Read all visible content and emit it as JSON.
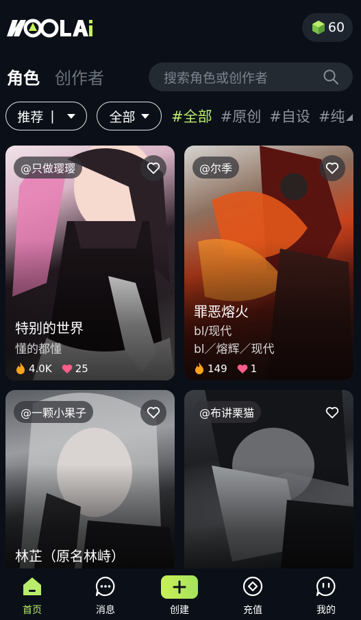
{
  "header": {
    "logo_text": "LOLAi",
    "gem_count": "60"
  },
  "tabs": {
    "role": "角色",
    "creator": "创作者"
  },
  "search": {
    "placeholder": "搜索角色或创作者"
  },
  "filters": {
    "sort_label": "推荐",
    "sort_separator": "|",
    "category_label": "全部",
    "hashtags": [
      "#全部",
      "#原创",
      "#自设",
      "#纯"
    ]
  },
  "cards": [
    {
      "author": "@只做璎璎",
      "title": "特别的世界",
      "subtitle": "懂的都懂",
      "tags": "",
      "views": "4.0K",
      "likes": "25"
    },
    {
      "author": "@尔季",
      "title": "罪恶熔火",
      "subtitle": "bl/现代",
      "tags": "bl／熔辉／现代",
      "views": "149",
      "likes": "1"
    },
    {
      "author": "@一颗小果子",
      "title": "林芷（原名林峙）",
      "subtitle": "",
      "tags": "",
      "views": "",
      "likes": ""
    },
    {
      "author": "@布讲栗猫",
      "title": "",
      "subtitle": "",
      "tags": "",
      "views": "",
      "likes": ""
    }
  ],
  "nav": {
    "home": "首页",
    "messages": "消息",
    "create": "创建",
    "recharge": "充值",
    "mine": "我的"
  },
  "colors": {
    "accent": "#b9ec6a",
    "background": "#0b1018",
    "heart": "#ff5c8a",
    "fire": "#ffa31a"
  }
}
